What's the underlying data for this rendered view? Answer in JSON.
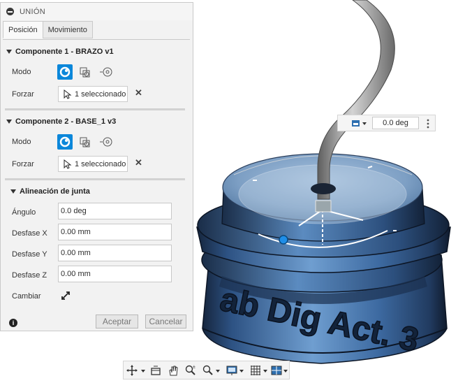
{
  "panel": {
    "title": "UNIÓN",
    "tabs": [
      "Posición",
      "Movimiento"
    ],
    "component1": {
      "header": "Componente 1 - BRAZO v1",
      "mode_label": "Modo",
      "force_label": "Forzar",
      "selection": "1 seleccionado"
    },
    "component2": {
      "header": "Componente 2 - BASE_1 v3",
      "mode_label": "Modo",
      "force_label": "Forzar",
      "selection": "1 seleccionado"
    },
    "alignment": {
      "header": "Alineación de junta",
      "angle_label": "Ángulo",
      "angle_value": "0.0 deg",
      "offset_x_label": "Desfase X",
      "offset_x_value": "0.00 mm",
      "offset_y_label": "Desfase Y",
      "offset_y_value": "0.00 mm",
      "offset_z_label": "Desfase Z",
      "offset_z_value": "0.00 mm",
      "flip_label": "Cambiar"
    },
    "accept_label": "Aceptar",
    "cancel_label": "Cancelar"
  },
  "angle_widget": {
    "value": "0.0 deg"
  },
  "model": {
    "engraved_text": "ab Dig Act. 3"
  },
  "colors": {
    "accent": "#0b87da",
    "model_blue": "#3a6ea8",
    "shaft": "#8a8a8a"
  }
}
